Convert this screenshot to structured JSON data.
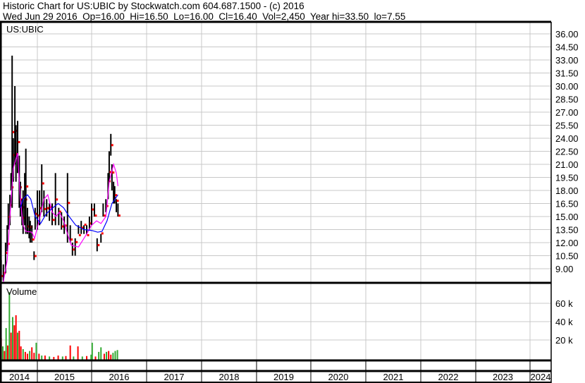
{
  "header": {
    "title": "Historic Chart for US:UBIC by Stockwatch.com 604.687.1500 - (c) 2016",
    "quote": "Wed Jun 29 2016  Op=16.00  Hi=16.50  Lo=16.00  Cl=16.40  Vol=2,450  Year hi=33.50  lo=7.55"
  },
  "chart_data": [
    {
      "type": "ohlc",
      "title": "US:UBIC",
      "ylim": [
        7.55,
        37.5
      ],
      "yticks": [
        "36.00",
        "34.50",
        "33.00",
        "31.50",
        "30.00",
        "28.50",
        "27.00",
        "25.50",
        "24.00",
        "22.50",
        "21.00",
        "19.50",
        "18.00",
        "16.50",
        "15.00",
        "13.50",
        "12.00",
        "10.50",
        "9.00"
      ],
      "ytick_values": [
        36,
        34.5,
        33,
        31.5,
        30,
        28.5,
        27,
        25.5,
        24,
        22.5,
        21,
        19.5,
        18,
        16.5,
        15,
        13.5,
        12,
        10.5,
        9
      ],
      "bars": [
        [
          2014.34,
          10,
          7.6
        ],
        [
          2014.38,
          9.5,
          7.6
        ],
        [
          2014.42,
          12,
          8.5
        ],
        [
          2014.45,
          14,
          11
        ],
        [
          2014.47,
          16.5,
          13.5
        ],
        [
          2014.5,
          17.5,
          14
        ],
        [
          2014.52,
          20,
          18
        ],
        [
          2014.54,
          33.5,
          16
        ],
        [
          2014.56,
          24,
          19
        ],
        [
          2014.59,
          30,
          21
        ],
        [
          2014.61,
          25.5,
          19
        ],
        [
          2014.64,
          26,
          20
        ],
        [
          2014.67,
          22,
          16
        ],
        [
          2014.69,
          19,
          15
        ],
        [
          2014.72,
          17,
          14
        ],
        [
          2014.74,
          18,
          13
        ],
        [
          2014.77,
          20,
          14
        ],
        [
          2014.79,
          22.8,
          13
        ],
        [
          2014.82,
          16,
          13
        ],
        [
          2014.85,
          15,
          12.5
        ],
        [
          2014.87,
          14.5,
          12
        ],
        [
          2014.9,
          14,
          12
        ],
        [
          2014.94,
          11,
          10
        ],
        [
          2014.96,
          16,
          13.5
        ],
        [
          2015.0,
          18,
          13.5
        ],
        [
          2015.04,
          18,
          14
        ],
        [
          2015.08,
          21,
          15.5
        ],
        [
          2015.12,
          18,
          15
        ],
        [
          2015.17,
          17,
          15
        ],
        [
          2015.22,
          16.5,
          14.5
        ],
        [
          2015.27,
          16.5,
          14
        ],
        [
          2015.33,
          20,
          14
        ],
        [
          2015.39,
          16,
          14
        ],
        [
          2015.44,
          15.5,
          13.5
        ],
        [
          2015.49,
          15,
          13
        ],
        [
          2015.55,
          20,
          12
        ],
        [
          2015.6,
          14,
          12
        ],
        [
          2015.64,
          12,
          10.5
        ],
        [
          2015.69,
          12.5,
          10.5
        ],
        [
          2015.75,
          14,
          13
        ],
        [
          2015.8,
          14.5,
          13
        ],
        [
          2015.85,
          14,
          13
        ],
        [
          2015.9,
          14,
          13
        ],
        [
          2015.95,
          15,
          13.5
        ],
        [
          2015.99,
          16.5,
          14
        ],
        [
          2016.04,
          16.5,
          15
        ],
        [
          2016.09,
          12.5,
          11
        ],
        [
          2016.16,
          13,
          12
        ],
        [
          2016.2,
          16.5,
          15
        ],
        [
          2016.25,
          17,
          15.5
        ],
        [
          2016.29,
          20,
          17
        ],
        [
          2016.31,
          22.5,
          19
        ],
        [
          2016.34,
          24.5,
          22
        ],
        [
          2016.36,
          21,
          18
        ],
        [
          2016.39,
          19,
          16.5
        ],
        [
          2016.41,
          18.5,
          16.5
        ],
        [
          2016.44,
          17,
          15.5
        ],
        [
          2016.47,
          16.5,
          15
        ]
      ],
      "ma_short": [
        [
          2014.38,
          7.5
        ],
        [
          2014.45,
          10
        ],
        [
          2014.5,
          15
        ],
        [
          2014.56,
          20.5
        ],
        [
          2014.64,
          22.3
        ],
        [
          2014.69,
          17
        ],
        [
          2014.74,
          14
        ],
        [
          2014.79,
          13.3
        ],
        [
          2014.9,
          13.2
        ],
        [
          2014.95,
          12.5
        ],
        [
          2015.05,
          15
        ],
        [
          2015.12,
          17
        ],
        [
          2015.19,
          17.5
        ],
        [
          2015.27,
          15.5
        ],
        [
          2015.34,
          15
        ],
        [
          2015.4,
          15.5
        ],
        [
          2015.48,
          14.5
        ],
        [
          2015.55,
          13
        ],
        [
          2015.62,
          11.7
        ],
        [
          2015.75,
          11.5
        ],
        [
          2015.9,
          13
        ],
        [
          2015.99,
          14
        ],
        [
          2016.08,
          14.5
        ],
        [
          2016.16,
          14.2
        ],
        [
          2016.25,
          15
        ],
        [
          2016.31,
          19
        ],
        [
          2016.39,
          21
        ],
        [
          2016.44,
          20
        ],
        [
          2016.47,
          18.5
        ]
      ],
      "ma_long": [
        [
          2014.69,
          16
        ],
        [
          2014.74,
          17
        ],
        [
          2014.82,
          17.5
        ],
        [
          2014.88,
          17
        ],
        [
          2014.96,
          15
        ],
        [
          2015.06,
          14.2
        ],
        [
          2015.16,
          15.3
        ],
        [
          2015.28,
          16
        ],
        [
          2015.38,
          16.5
        ],
        [
          2015.48,
          16
        ],
        [
          2015.58,
          15
        ],
        [
          2015.7,
          14
        ],
        [
          2015.85,
          13.5
        ],
        [
          2015.99,
          13.4
        ],
        [
          2016.1,
          13.2
        ],
        [
          2016.18,
          13.3
        ],
        [
          2016.27,
          14.5
        ],
        [
          2016.36,
          16.5
        ],
        [
          2016.47,
          17.5
        ]
      ]
    },
    {
      "type": "bar",
      "title": "Volume",
      "ylim": [
        0,
        80000
      ],
      "yticks": [
        "60 k",
        "40 k",
        "20 k"
      ],
      "ytick_values": [
        60000,
        40000,
        20000
      ],
      "bars": [
        [
          2014.34,
          22000,
          "red"
        ],
        [
          2014.37,
          13000,
          "green"
        ],
        [
          2014.4,
          8000,
          "red"
        ],
        [
          2014.43,
          33000,
          "green"
        ],
        [
          2014.46,
          14000,
          "red"
        ],
        [
          2014.49,
          72000,
          "green"
        ],
        [
          2014.52,
          28000,
          "red"
        ],
        [
          2014.55,
          45000,
          "green"
        ],
        [
          2014.58,
          36000,
          "red"
        ],
        [
          2014.61,
          47000,
          "red"
        ],
        [
          2014.64,
          28000,
          "green"
        ],
        [
          2014.67,
          30000,
          "red"
        ],
        [
          2014.7,
          13000,
          "red"
        ],
        [
          2014.74,
          10000,
          "green"
        ],
        [
          2014.78,
          7000,
          "red"
        ],
        [
          2014.82,
          5000,
          "red"
        ],
        [
          2014.86,
          8000,
          "green"
        ],
        [
          2014.9,
          12000,
          "red"
        ],
        [
          2014.94,
          6000,
          "red"
        ],
        [
          2014.98,
          17000,
          "green"
        ],
        [
          2015.03,
          5000,
          "red"
        ],
        [
          2015.08,
          3000,
          "green"
        ],
        [
          2015.14,
          3000,
          "red"
        ],
        [
          2015.22,
          2000,
          "green"
        ],
        [
          2015.3,
          1500,
          "red"
        ],
        [
          2015.38,
          3000,
          "red"
        ],
        [
          2015.46,
          2000,
          "green"
        ],
        [
          2015.52,
          2500,
          "red"
        ],
        [
          2015.6,
          14000,
          "red"
        ],
        [
          2015.66,
          2000,
          "green"
        ],
        [
          2015.74,
          13000,
          "red"
        ],
        [
          2015.82,
          2000,
          "green"
        ],
        [
          2015.9,
          2500,
          "red"
        ],
        [
          2015.98,
          4000,
          "green"
        ],
        [
          2016.0,
          17000,
          "green"
        ],
        [
          2016.06,
          2000,
          "red"
        ],
        [
          2016.12,
          7000,
          "green"
        ],
        [
          2016.16,
          12000,
          "green"
        ],
        [
          2016.22,
          5000,
          "red"
        ],
        [
          2016.26,
          7000,
          "green"
        ],
        [
          2016.3,
          8000,
          "red"
        ],
        [
          2016.34,
          4000,
          "red"
        ],
        [
          2016.38,
          6000,
          "green"
        ],
        [
          2016.42,
          8000,
          "green"
        ],
        [
          2016.46,
          9000,
          "green"
        ]
      ]
    }
  ],
  "xaxis": {
    "years": [
      "2014",
      "2015",
      "2016",
      "2017",
      "2018",
      "2019",
      "2020",
      "2021",
      "2022",
      "2023",
      "2024"
    ]
  },
  "colors": {
    "up": "#33aa33",
    "down": "#ff0000",
    "ma_short": "#ff00ff",
    "ma_long": "#0000ff",
    "grid": "#c8c8c8"
  }
}
